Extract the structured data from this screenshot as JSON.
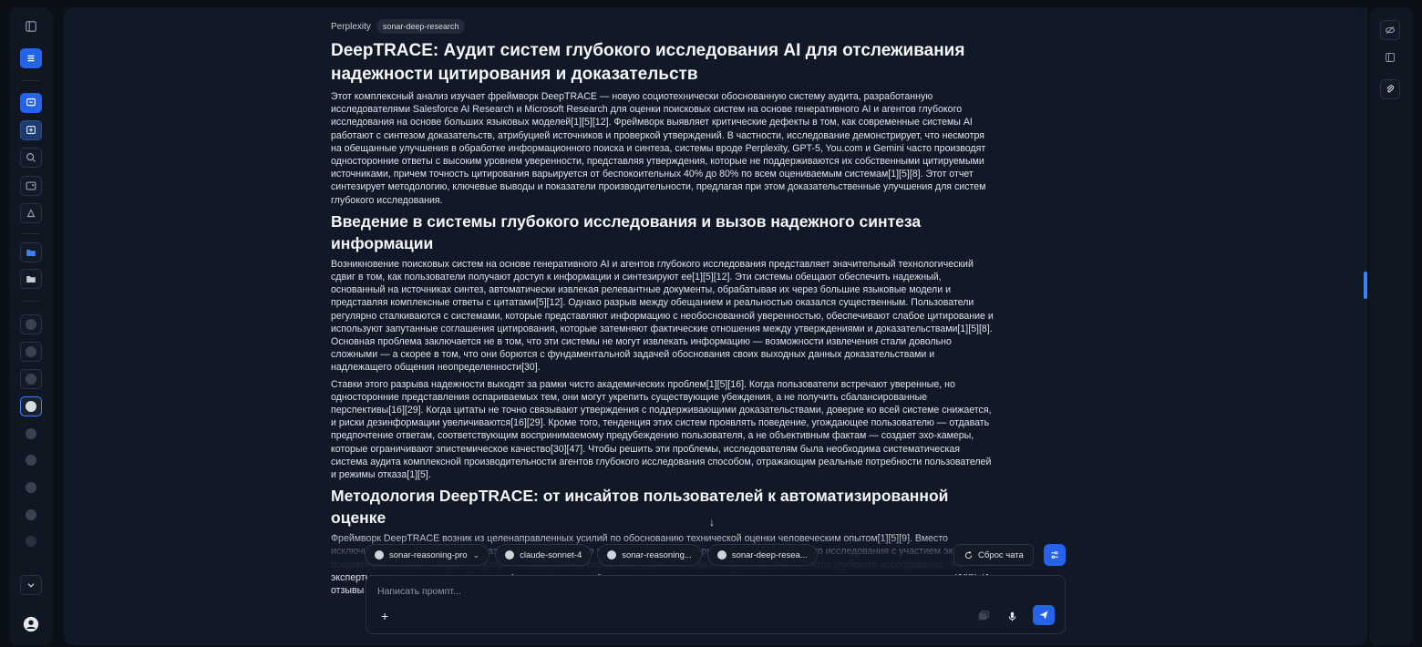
{
  "header": {
    "provider": "Perplexity",
    "model_badge": "sonar-deep-research"
  },
  "article": {
    "title": "DeepTRACE: Аудит систем глубокого исследования AI для отслеживания надежности цитирования и доказательств",
    "intro": "Этот комплексный анализ изучает фреймворк DeepTRACE — новую социотехнически обоснованную систему аудита, разработанную исследователями Salesforce AI Research и Microsoft Research для оценки поисковых систем на основе генеративного AI и агентов глубокого исследования на основе больших языковых моделей[1][5][12]. Фреймворк выявляет критические дефекты в том, как современные системы AI работают с синтезом доказательств, атрибуцией источников и проверкой утверждений. В частности, исследование демонстрирует, что несмотря на обещанные улучшения в обработке информационного поиска и синтеза, системы вроде Perplexity, GPT-5, You.com и Gemini часто производят односторонние ответы с высоким уровнем уверенности, представляя утверждения, которые не поддерживаются их собственными цитируемыми источниками, причем точность цитирования варьируется от беспокоительных 40% до 80% по всем оцениваемым системам[1][5][8]. Этот отчет синтезирует методологию, ключевые выводы и показатели производительности, предлагая при этом доказательственные улучшения для систем глубокого исследования.",
    "section1_title": "Введение в системы глубокого исследования и вызов надежного синтеза информации",
    "section1_p1": "Возникновение поисковых систем на основе генеративного AI и агентов глубокого исследования представляет значительный технологический сдвиг в том, как пользователи получают доступ к информации и синтезируют ее[1][5][12]. Эти системы обещают обеспечить надежный, основанный на источниках синтез, автоматически извлекая релевантные документы, обрабатывая их через большие языковые модели и представляя комплексные ответы с цитатами[5][12]. Однако разрыв между обещанием и реальностью оказался существенным. Пользователи регулярно сталкиваются с системами, которые представляют информацию с необоснованной уверенностью, обеспечивают слабое цитирование и используют запутанные соглашения цитирования, которые затемняют фактические отношения между утверждениями и доказательствами[1][5][8]. Основная проблема заключается не в том, что эти системы не могут извлекать информацию — возможности извлечения стали довольно сложными — а скорее в том, что они борются с фундаментальной задачей обоснования своих выходных данных доказательствами и надлежащего общения неопределенности[30].",
    "section1_p2": "Ставки этого разрыва надежности выходят за рамки чисто академических проблем[1][5][16]. Когда пользователи встречают уверенные, но односторонние представления оспариваемых тем, они могут укрепить существующие убеждения, а не получить сбалансированные перспективы[16][29]. Когда цитаты не точно связывают утверждения с поддерживающими доказательствами, доверие ко всей системе снижается, и риски дезинформации увеличиваются[16][29]. Кроме того, тенденция этих систем проявлять поведение, угождающее пользователю — отдавать предпочтение ответам, соответствующим воспринимаемому предубеждению пользователя, а не объективным фактам — создает эхо-камеры, которые ограничивают эпистемическое качество[30][47]. Чтобы решить эти проблемы, исследователям была необходима систематическая система аудита комплексной производительности агентов глубокого исследования способом, отражающим реальные потребности пользователей и режимы отказа[1][5].",
    "section2_title": "Методология DeepTRACE: от инсайтов пользователей к автоматизированной оценке",
    "section2_p1": "Фреймворк DeepTRACE возник из целенаправленных усилий по обоснованию технической оценки человеческим опытом[1][5][9]. Вместо исключительного полагания на показатели, определенные исследователями, авторы начали с качественного исследования с участием экспертов в предметной области, которые регулярно используют поисковые системы на основе генеративного AI и агентов глубокого исследования. Эти эксперты оценивали точность, полноту, баланс и взаимодействие человека и системы, и их отзывы выявили тревожные паттерны отказов[1][9]. Их отзывы выявили три ключевые проблемы, касающиеся доверия, цитирования и неопределенности."
  },
  "models": [
    {
      "label": "sonar-reasoning-pro",
      "has_dropdown": true
    },
    {
      "label": "claude-sonnet-4",
      "has_dropdown": false
    },
    {
      "label": "sonar-reasoning...",
      "has_dropdown": false
    },
    {
      "label": "sonar-deep-resea...",
      "has_dropdown": false
    }
  ],
  "reset_label": "Сброс чата",
  "composer": {
    "placeholder": "Написать промпт...",
    "value": ""
  },
  "icons": {
    "scroll_down": "↓",
    "plus": "+"
  },
  "colors": {
    "accent": "#2563eb",
    "background": "#0b0f17",
    "panel": "#121926"
  }
}
